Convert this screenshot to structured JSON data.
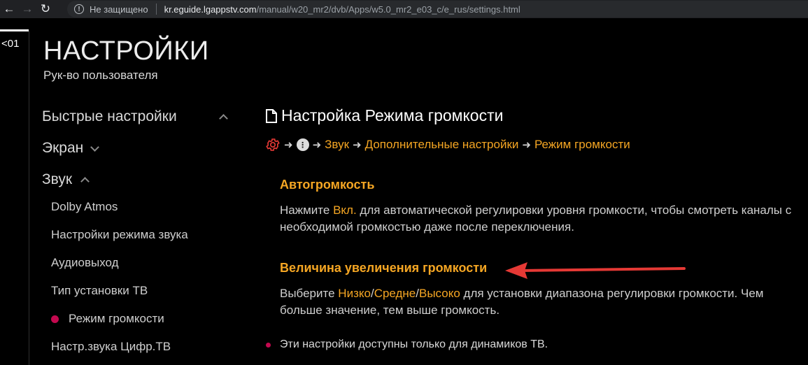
{
  "browser": {
    "security_label": "Не защищено",
    "host": "kr.eguide.lgappstv.com",
    "path": "/manual/w20_mr2/dvb/Apps/w5.0_mr2_e03_c/e_rus/settings.html"
  },
  "page": {
    "number": "<01",
    "title": "НАСТРОЙКИ",
    "subtitle": "Рук-во пользователя"
  },
  "sidebar": {
    "sections": [
      {
        "label": "Быстрые настройки",
        "expanded": true
      },
      {
        "label": "Экран",
        "expanded": false
      },
      {
        "label": "Звук",
        "expanded": true
      }
    ],
    "sound_items": [
      "Dolby Atmos",
      "Настройки режима звука",
      "Аудиовыход",
      "Тип установки ТВ",
      "Режим громкости",
      "Настр.звука Цифр.ТВ"
    ],
    "active_index": 4
  },
  "content": {
    "title": "Настройка Режима громкости",
    "breadcrumb": [
      "Звук",
      "Дополнительные настройки",
      "Режим громкости"
    ],
    "section1": {
      "heading": "Автогромкость",
      "text_pre": "Нажмите ",
      "highlight": "Вкл.",
      "text_post": " для автоматической регулировки уровня громкости, чтобы смотреть каналы с необходимой громкостью даже после переключения."
    },
    "section2": {
      "heading": "Величина увеличения громкости",
      "text_pre": "Выберите ",
      "opt1": "Низко",
      "slash": "/",
      "opt2": "Средне",
      "opt3": "Высоко",
      "text_post": " для установки диапазона регулировки громкости. Чем больше значение, тем выше громкость."
    },
    "note": "Эти настройки доступны только для динамиков ТВ."
  },
  "colors": {
    "accent": "#f5a623",
    "dot": "#c4094f",
    "arrow": "#e53935"
  }
}
